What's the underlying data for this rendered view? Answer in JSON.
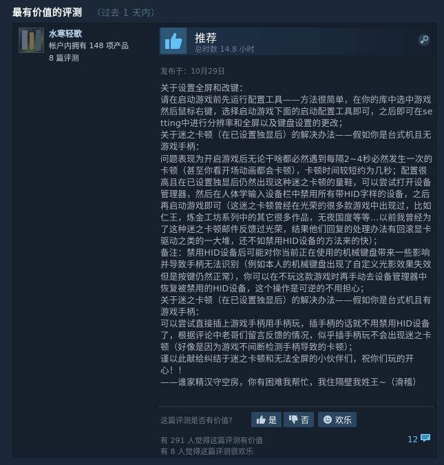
{
  "header": {
    "title": "最有价值的评测",
    "range": "（过去 1 天内）"
  },
  "author": {
    "name": "水寒轻歌",
    "products": "帐户内拥有 148 项产品",
    "reviews": "8 篇评测"
  },
  "review": {
    "verdict": "推荐",
    "hours": "总时数 14.8 小时",
    "posted": "发布于：10月29日",
    "lines": [
      "关于设置全屏和改键：",
      "请在启动游戏前先运行配置工具——方法很简单，在你的库中选中游戏然后鼠标右键，选择启动游戏下面的启动配置工具即可，之后即可在setting中进行分辨率和全屏以及键盘设置的更改；",
      "关于迷之卡顿（在已设置独显后）的解决办法——假如你是台式机且无游戏手柄：",
      "问题表现为开启游戏后无论干啥都必然遇到每隔2~4秒必然发生一次的卡顿（甚至你看开场动画都会卡顿），卡顿时间较短约为几秒；配置很高且在已设置独显后仍然出现这种迷之卡顿的童鞋，可以尝试打开设备管理器，然后在人体学输入设备栏中禁用所有带HID字样的设备，之后再启动游戏即可（这迷之卡顿曾经在光荣的很多款游戏中出现过，比如仁王，炼金工坊系列中的其它很多作品，无夜国度等等…以前我曾经为了这种迷之卡顿邮件反馈过光荣，结果他们回复的处理办法有回滚显卡驱动之类的一大堆，还不如禁用HID设备的方法来的快）；",
      "备注：禁用HID设备后可能对你当前正在使用的机械键盘带来一些影响并导致手柄无法识别（例如本人的机械键盘出现了自定义光影效果失效但是按键仍然正常），你可以在不玩这款游戏时再手动去设备管理器中恢复被禁用的HID设备，这个操作是可逆的不用担心；",
      "关于迷之卡顿（在已设置独显后）的解决办法——假如你是台式机且有游戏手柄：",
      "可以尝试直接插上游戏手柄用手柄玩，插手柄的话就不用禁用HID设备了，根据评论中老哥们留言反馈的情况，似乎插手柄玩不会出现迷之卡顿（好像是因为游戏不间断检测手柄导致的卡顿）；",
      "谨以此献给纠结于迷之卡顿和无法全屏的小伙伴们，祝你们玩的开心！！",
      "——谁家精汉守空房，你有困难我帮忙，我住隔壁我姓王~（滑稽）"
    ]
  },
  "feedback": {
    "question": "这篇评测是否有价值?",
    "yes_label": "是",
    "no_label": "否",
    "funny_label": "欢乐",
    "helpful_count": "有 291 人觉得这篇评测有价值",
    "funny_count": "有 8 人觉得这篇评测很欢乐",
    "comment_count": "12"
  },
  "colors": {
    "background": "#1b2838",
    "card": "#16202d",
    "accent_link": "#66c0f4",
    "button": "#2a4660"
  },
  "icons": [
    "thumbs-up-icon",
    "steam-logo-icon",
    "thumbs-down-icon",
    "smiley-icon",
    "comment-icon"
  ]
}
